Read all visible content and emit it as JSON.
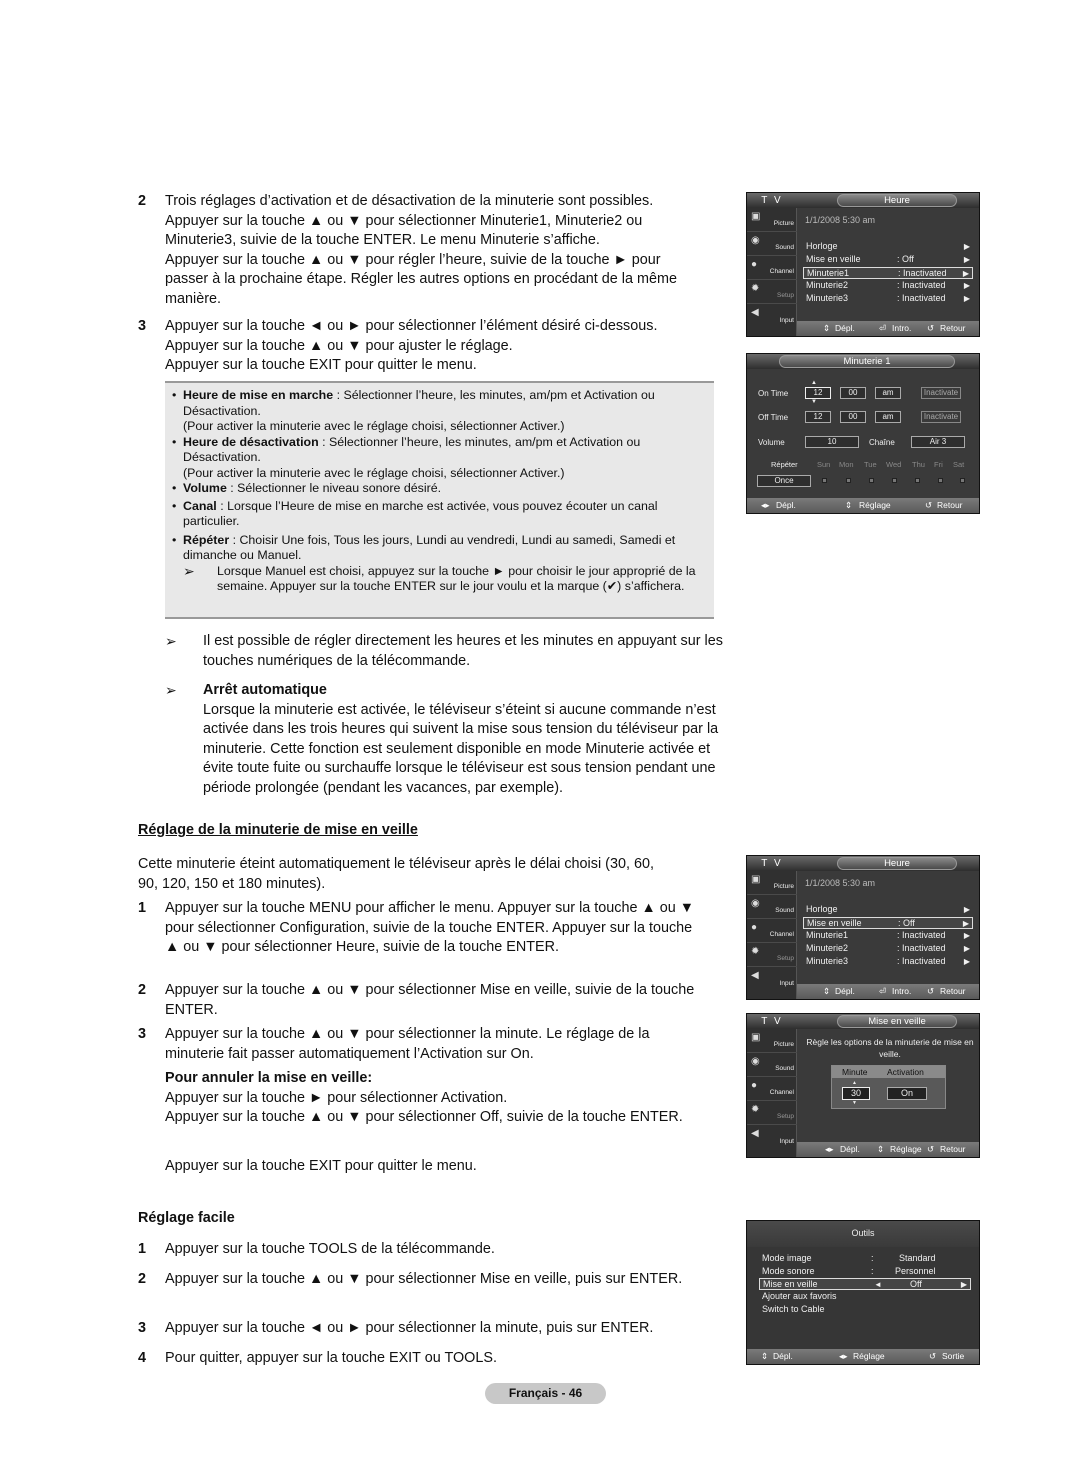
{
  "section1": {
    "step2_num": "2",
    "step2_lines": [
      "Trois réglages d’activation et de désactivation de la minuterie sont possibles.",
      "Appuyer sur la touche ▲ ou ▼ pour sélectionner Minuterie1, Minuterie2  ou",
      "Minuterie3, suivie de la touche ENTER. Le menu Minuterie s’affiche.",
      "Appuyer sur la touche ▲ ou ▼ pour régler l’heure, suivie de la touche ► pour",
      "passer à la prochaine étape. Régler les autres options en procédant de la même",
      "manière."
    ],
    "step3_num": "3",
    "step3_lines": [
      "Appuyer sur la touche ◄ ou ► pour sélectionner l’élément désiré ci-dessous.",
      "Appuyer sur la touche ▲ ou ▼ pour ajuster le réglage.",
      "Appuyer sur la touche EXIT pour quitter le menu."
    ],
    "notes": [
      {
        "term": "Heure de mise en marche",
        "text": " : Sélectionner l’heure, les minutes, am/pm et Activation ou Désactivation.",
        "extra": "(Pour activer la minuterie avec le réglage choisi, sélectionner Activer.)"
      },
      {
        "term": "Heure de désactivation",
        "text": " : Sélectionner l’heure, les minutes, am/pm et Activation ou Désactivation.",
        "extra": "(Pour activer la minuterie avec le réglage choisi, sélectionner Activer.)"
      },
      {
        "term": "Volume",
        "text": " : Sélectionner le niveau sonore désiré.",
        "extra": ""
      },
      {
        "term": "Canal",
        "text": " : Lorsque l’Heure de mise en marche est activée, vous pouvez écouter un canal particulier.",
        "extra": ""
      },
      {
        "term": "Répéter",
        "text": " : Choisir Une fois, Tous les jours, Lundi au vendredi, Lundi au samedi, Samedi et dimanche ou Manuel.",
        "extra": ""
      }
    ],
    "manual_note": "Lorsque Manuel est choisi, appuyez sur la touche ► pour choisir le jour approprié de la semaine. Appuyer sur la touche ENTER sur le jour voulu et la marque (✔) s’affichera.",
    "tip1": "Il est possible de régler directement les heures et les minutes en appuyant sur les touches numériques de la télécommande.",
    "auto_off_title": "Arrêt automatique",
    "auto_off_text": "Lorsque la minuterie est activée, le téléviseur s’éteint si aucune commande n’est activée dans les trois heures qui suivent la mise sous tension du téléviseur par la minuterie. Cette fonction est seulement disponible en mode Minuterie activée et évite toute fuite ou surchauffe lorsque le téléviseur est sous tension pendant une période prolongée (pendant les vacances, par exemple)."
  },
  "section2": {
    "title": "Réglage de la minuterie de mise en veille",
    "intro": "Cette minuterie éteint automatiquement le téléviseur après le délai choisi (30, 60, 90, 120, 150 et 180 minutes).",
    "steps": [
      {
        "num": "1",
        "text": "Appuyer sur la touche MENU pour afficher le menu. Appuyer sur la touche ▲ ou ▼ pour sélectionner Configuration, suivie de la touche ENTER. Appuyer sur la touche ▲ ou ▼ pour sélectionner Heure, suivie de la touche ENTER."
      },
      {
        "num": "2",
        "text": "Appuyer sur la touche ▲ ou ▼ pour sélectionner Mise en veille, suivie de la touche ENTER."
      },
      {
        "num": "3",
        "text": "Appuyer sur la touche ▲ ou ▼ pour sélectionner la minute. Le réglage de la minuterie fait passer automatiquement l’Activation sur On."
      }
    ],
    "cancel_title": "Pour annuler la mise en veille:",
    "cancel_lines": [
      "Appuyer sur la touche ► pour sélectionner Activation.",
      "Appuyer sur la touche ▲ ou ▼ pour sélectionner Off, suivie de la touche ENTER."
    ],
    "exit_line": "Appuyer sur la touche EXIT pour quitter le menu."
  },
  "section3": {
    "title": "Réglage facile",
    "steps": [
      {
        "num": "1",
        "text": "Appuyer sur la touche TOOLS de la télécommande."
      },
      {
        "num": "2",
        "text": "Appuyer sur la touche ▲ ou ▼ pour sélectionner Mise en veille, puis sur ENTER."
      },
      {
        "num": "3",
        "text": "Appuyer sur la touche ◄ ou ► pour sélectionner la minute, puis sur ENTER."
      },
      {
        "num": "4",
        "text": "Pour quitter, appuyer sur la touche EXIT ou TOOLS."
      }
    ]
  },
  "footer": {
    "page_label": "Français - 46"
  },
  "tv_common": {
    "tv_label": "T V",
    "sidebar": [
      "Picture",
      "Sound",
      "Channel",
      "Setup",
      "Input"
    ]
  },
  "screen_heure": {
    "title": "Heure",
    "date": "1/1/2008 5:30 am",
    "rows": [
      {
        "label": "Horloge",
        "value": ""
      },
      {
        "label": "Mise en veille",
        "value": ": Off"
      },
      {
        "label": "Minuterie1",
        "value": ": Inactivated"
      },
      {
        "label": "Minuterie2",
        "value": ": Inactivated"
      },
      {
        "label": "Minuterie3",
        "value": ": Inactivated"
      }
    ],
    "footer": {
      "move": "Dépl.",
      "enter": "Intro.",
      "back": "Retour"
    }
  },
  "screen_minuterie": {
    "title": "Minuterie 1",
    "on_time_label": "On Time",
    "on_hour": "12",
    "on_min": "00",
    "on_ampm": "am",
    "on_state": "Inactivate",
    "off_time_label": "Off Time",
    "off_hour": "12",
    "off_min": "00",
    "off_ampm": "am",
    "off_state": "Inactivate",
    "volume_label": "Volume",
    "volume_value": "10",
    "channel_label": "Chaîne",
    "channel_value": "Air 3",
    "repeat_label": "Répéter",
    "repeat_value": "Once",
    "days": [
      "Sun",
      "Mon",
      "Tue",
      "Wed",
      "Thu",
      "Fri",
      "Sat"
    ],
    "footer": {
      "move": "Dépl.",
      "adjust": "Réglage",
      "back": "Retour"
    }
  },
  "screen_veille": {
    "title": "Mise en veille",
    "desc": "Règle les options de la minuterie de mise en veille.",
    "minute_label": "Minute",
    "activation_label": "Activation",
    "minute_value": "30",
    "activation_value": "On",
    "footer": {
      "move": "Dépl.",
      "adjust": "Réglage",
      "back": "Retour"
    }
  },
  "screen_outils": {
    "title": "Outils",
    "rows": [
      {
        "label": "Mode image",
        "sep": ":",
        "value": "Standard"
      },
      {
        "label": "Mode sonore",
        "sep": ":",
        "value": "Personnel"
      },
      {
        "label": "Mise en veille",
        "sep": "◄",
        "value": "Off"
      },
      {
        "label": "Ajouter aux favoris",
        "sep": "",
        "value": ""
      },
      {
        "label": "Switch to Cable",
        "sep": "",
        "value": ""
      }
    ],
    "footer": {
      "move": "Dépl.",
      "adjust": "Réglage",
      "exit": "Sortie"
    }
  }
}
